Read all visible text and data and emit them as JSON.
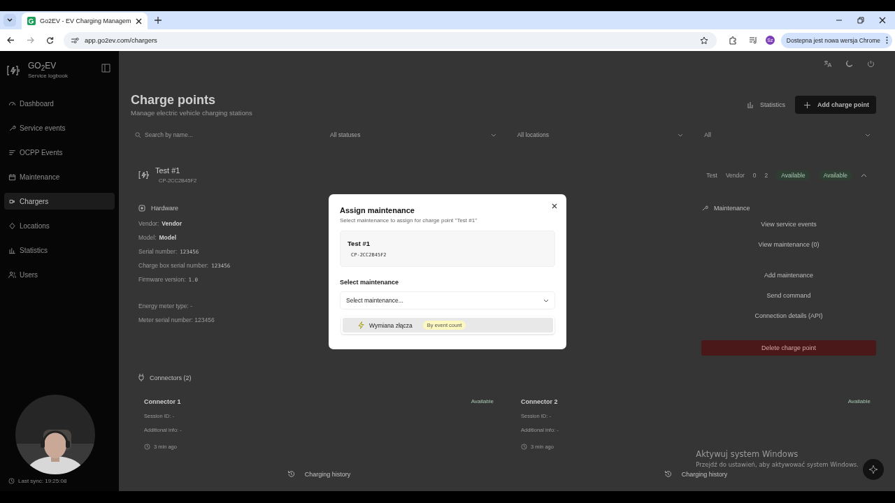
{
  "browser": {
    "tab_title": "Go2EV - EV Charging Managem",
    "url": "app.go2ev.com/chargers",
    "profile": "Sz",
    "update_notice": "Dostepna jest nowa wersja Chrome"
  },
  "sidebar": {
    "brand": "GO$_{2}$EV",
    "tagline": "Service logbook",
    "items": [
      {
        "label": "Dashboard",
        "selected": false
      },
      {
        "label": "Service events",
        "selected": false
      },
      {
        "label": "OCPP Events",
        "selected": false
      },
      {
        "label": "Maintenance",
        "selected": false
      },
      {
        "label": "Chargers",
        "selected": true
      },
      {
        "label": "Locations",
        "selected": false
      },
      {
        "label": "Statistics",
        "selected": false
      },
      {
        "label": "Users",
        "selected": false
      }
    ],
    "last_sync": "Last sync: 19:25:08"
  },
  "header": {
    "title": "Charge points",
    "subtitle": "Manage electric vehicle charging stations",
    "statistics": "Statistics",
    "add": "Add charge point"
  },
  "filters": {
    "search_placeholder": "Search by name...",
    "selects": [
      "All statuses",
      "All locations",
      "All"
    ]
  },
  "charger": {
    "name": "Test #1",
    "id": "CP-2CC2B45F2",
    "expanded": true,
    "badges": [
      {
        "kind": "tag",
        "label": "Test"
      },
      {
        "kind": "tag",
        "label": "Vendor"
      },
      {
        "kind": "count",
        "label": "0"
      },
      {
        "kind": "count",
        "label": "2"
      },
      {
        "kind": "status",
        "label": "Available"
      },
      {
        "kind": "status",
        "label": "Available"
      }
    ],
    "hardware": {
      "title": "Hardware",
      "rows": [
        {
          "kind": "strong",
          "label": "Vendor:",
          "value": "Vendor"
        },
        {
          "kind": "strong",
          "label": "Model:",
          "value": "Model"
        },
        {
          "kind": "plain",
          "label": "Serial number:",
          "value": "123456"
        },
        {
          "kind": "plain",
          "label": "Charge box serial number:",
          "value": "123456"
        },
        {
          "kind": "plain",
          "label": "Firmware version:",
          "value": "1.0"
        }
      ],
      "meter_rows": [
        "Energy meter type: -",
        "Meter serial number: 123456"
      ]
    },
    "maintenance": {
      "title": "Maintenance",
      "actions": [
        {
          "kind": "plain",
          "label": "View service events"
        },
        {
          "kind": "plain",
          "label": "View maintenance (0)"
        },
        {
          "kind": "plain",
          "label": "Add maintenance"
        },
        {
          "kind": "plain",
          "label": "Send command"
        },
        {
          "kind": "plain",
          "label": "Connection details (API)"
        },
        {
          "kind": "danger",
          "label": "Delete charge point"
        }
      ]
    },
    "connectors": {
      "title": "Connectors (2)",
      "items": [
        {
          "name": "Connector 1",
          "status": "Available",
          "session": "Session ID: -",
          "info": "Additional info: -",
          "time": "3 min ago",
          "history": "Charging history"
        },
        {
          "name": "Connector 2",
          "status": "Available",
          "session": "Session ID: -",
          "info": "Additional info: -",
          "time": "3 min ago",
          "history": "Charging history"
        }
      ]
    }
  },
  "modal": {
    "title": "Assign maintenance",
    "description": "Select maintenance to assign for charge point \"Test #1\"",
    "charger_name": "Test #1",
    "charger_id": "CP-2CC2B45F2",
    "field_label": "Select maintenance",
    "select_placeholder": "Select maintenance...",
    "expanded": true,
    "options": [
      {
        "label": "Wymiana złącza",
        "tag": "By event count"
      }
    ]
  },
  "windows_notice": {
    "title": "Aktywuj system Windows",
    "text": "Przejdź do ustawień, aby aktywować system Windows."
  }
}
